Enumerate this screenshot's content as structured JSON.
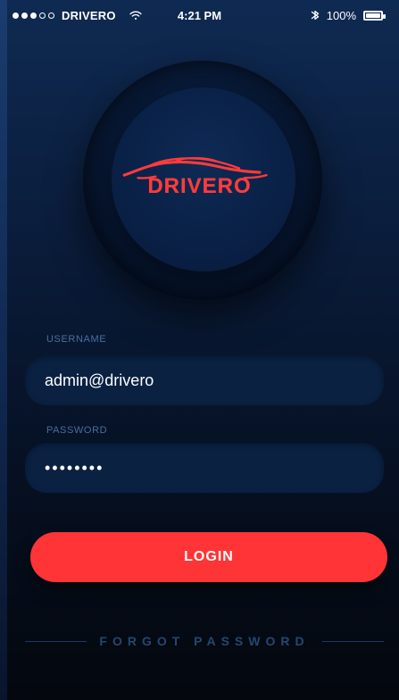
{
  "status_bar": {
    "carrier": "DRIVERO",
    "time": "4:21 PM",
    "battery": "100%"
  },
  "brand": {
    "name": "DRIVERO",
    "accent": "#ff3b3b"
  },
  "form": {
    "username_label": "USERNAME",
    "username_value": "admin@drivero",
    "password_label": "PASSWORD",
    "password_value": "••••••••",
    "login_label": "LOGIN",
    "forgot_label": "FORGOT PASSWORD"
  },
  "icons": {
    "signal": "signal-dots-icon",
    "wifi": "wifi-icon",
    "bluetooth": "bluetooth-icon",
    "battery": "battery-icon",
    "car": "car-logo-icon"
  }
}
